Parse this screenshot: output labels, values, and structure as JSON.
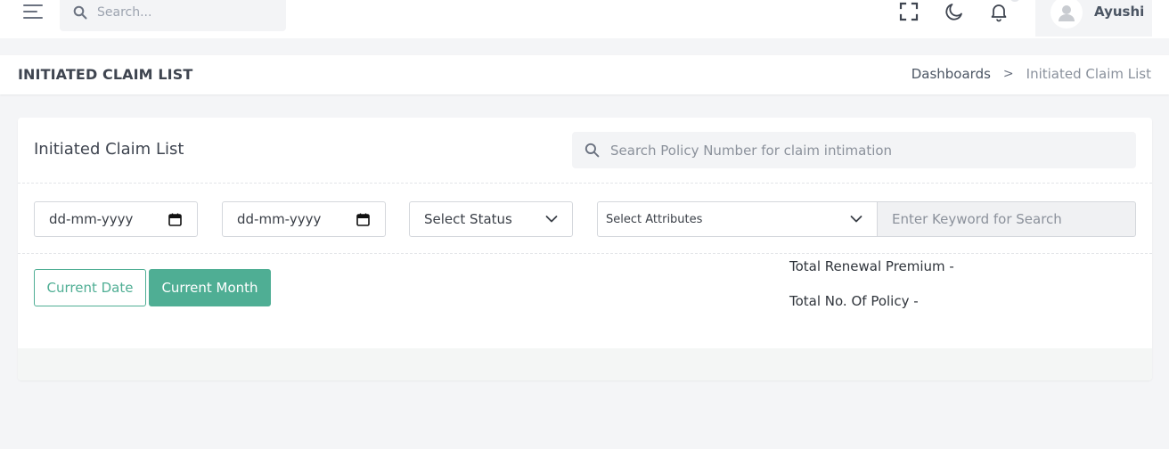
{
  "header": {
    "search_placeholder": "Search...",
    "user_name": "Ayushi",
    "icons": [
      "menu-icon",
      "search-icon",
      "fullscreen-icon",
      "moon-icon",
      "bell-icon",
      "user-icon"
    ]
  },
  "page": {
    "title": "INITIATED CLAIM LIST",
    "breadcrumb": {
      "items": [
        {
          "label": "Dashboards"
        },
        {
          "label": "Initiated Claim List"
        }
      ],
      "separator": ">"
    }
  },
  "card": {
    "title": "Initiated Claim List",
    "policy_search_placeholder": "Search Policy Number for claim intimation",
    "filters": {
      "date_from": "dd-mm-yyyy",
      "date_to": "dd-mm-yyyy",
      "status": "Select Status",
      "attributes": "Select Attributes",
      "keyword_placeholder": "Enter Keyword for Search"
    },
    "buttons": {
      "current_date": "Current Date",
      "current_month": "Current Month"
    },
    "summary": {
      "total_renewal_premium": "Total Renewal Premium -",
      "total_policies": "Total No. Of Policy -"
    }
  },
  "colors": {
    "accent": "#4fae94",
    "background": "#f4f5f7",
    "surface": "#ffffff"
  }
}
